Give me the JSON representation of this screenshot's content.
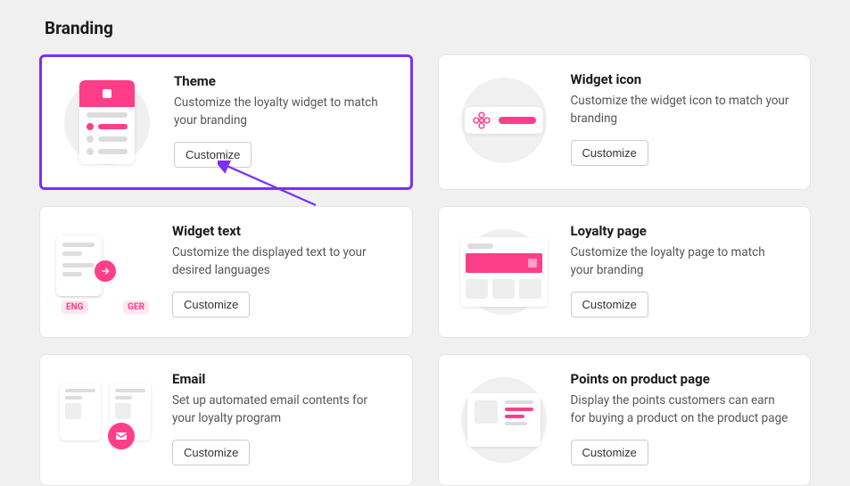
{
  "page": {
    "title": "Branding"
  },
  "cards": {
    "theme": {
      "title": "Theme",
      "desc": "Customize the loyalty widget to match your branding",
      "button": "Customize"
    },
    "widget_icon": {
      "title": "Widget icon",
      "desc": "Customize the widget icon to match your branding",
      "button": "Customize"
    },
    "widget_text": {
      "title": "Widget text",
      "desc": "Customize the displayed text to your desired languages",
      "button": "Customize",
      "lang_left": "ENG",
      "lang_right": "GER"
    },
    "loyalty_page": {
      "title": "Loyalty page",
      "desc": "Customize the loyalty page to match your branding",
      "button": "Customize"
    },
    "email": {
      "title": "Email",
      "desc": "Set up automated email contents for your loyalty program",
      "button": "Customize"
    },
    "points": {
      "title": "Points on product page",
      "desc": "Display the points customers can earn for buying a product on the product page",
      "button": "Customize"
    }
  },
  "colors": {
    "accent": "#ff3e89",
    "highlight_border": "#7b2ff7"
  }
}
